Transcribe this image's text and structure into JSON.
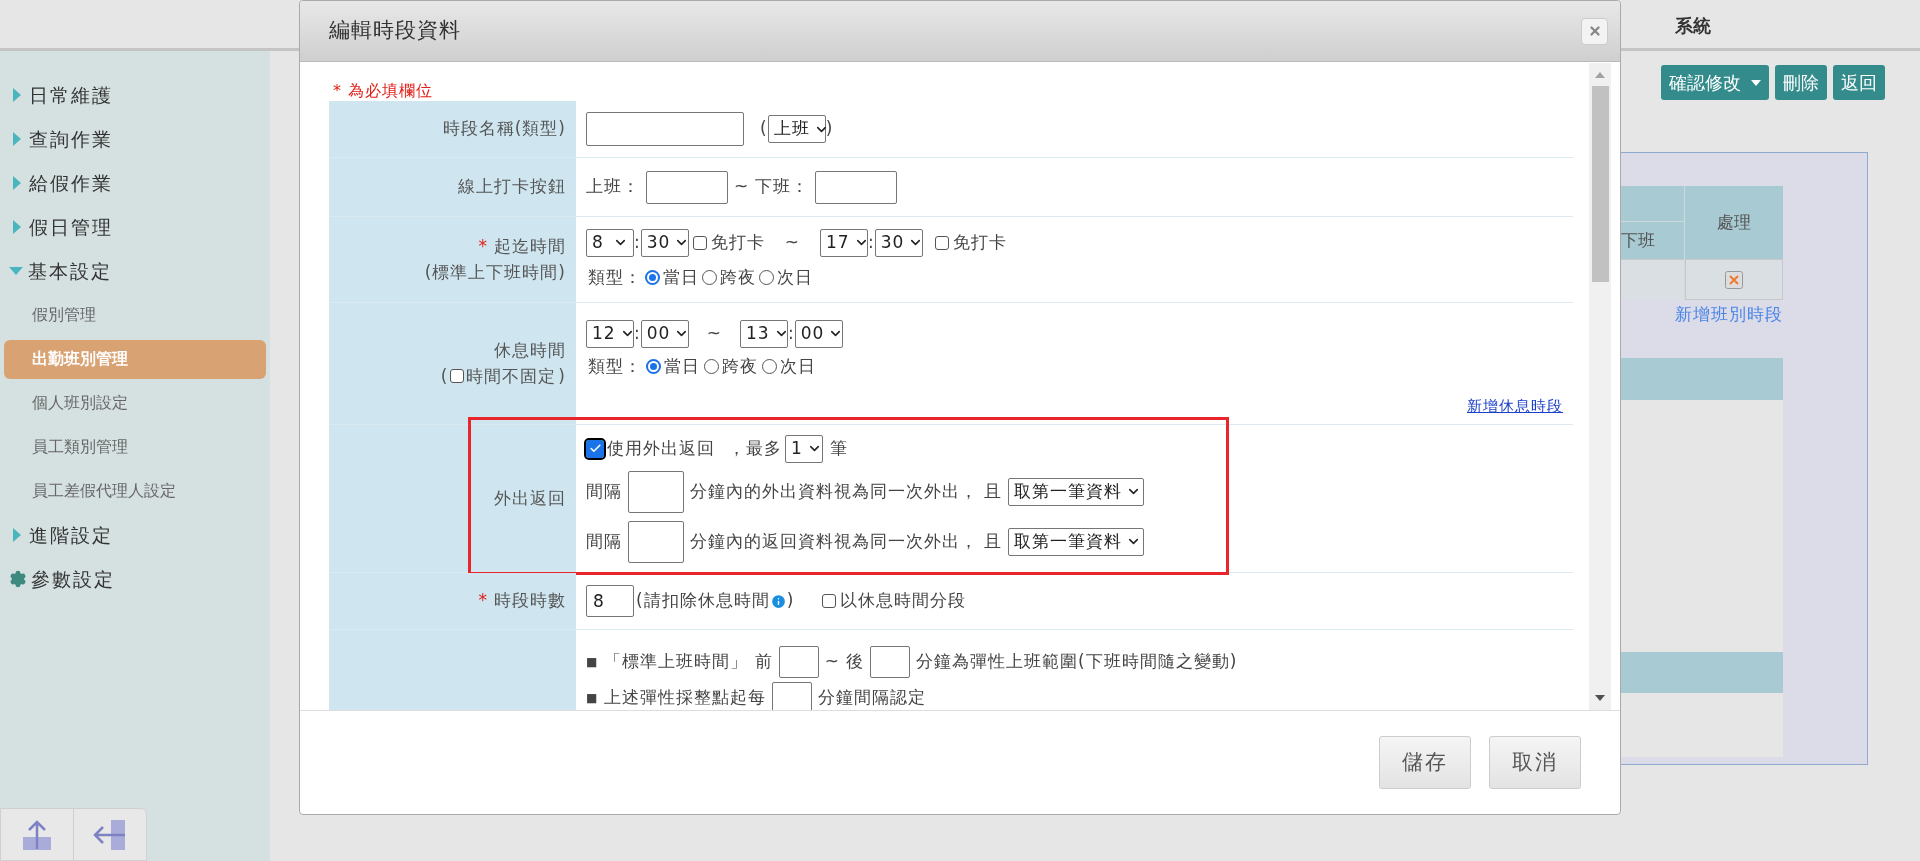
{
  "top_bar": {
    "title": "系統"
  },
  "sidebar": {
    "items": [
      {
        "label": "日常維護",
        "kind": "group",
        "expanded": false
      },
      {
        "label": "查詢作業",
        "kind": "group",
        "expanded": false
      },
      {
        "label": "給假作業",
        "kind": "group",
        "expanded": false
      },
      {
        "label": "假日管理",
        "kind": "group",
        "expanded": false
      },
      {
        "label": "基本設定",
        "kind": "group",
        "expanded": true,
        "children": [
          {
            "label": "假別管理",
            "selected": false
          },
          {
            "label": "出勤班別管理",
            "selected": true
          },
          {
            "label": "個人班別設定",
            "selected": false
          },
          {
            "label": "員工類別管理",
            "selected": false
          },
          {
            "label": "員工差假代理人設定",
            "selected": false
          }
        ]
      },
      {
        "label": "進階設定",
        "kind": "group",
        "expanded": false
      },
      {
        "label": "參數設定",
        "kind": "settings"
      }
    ]
  },
  "toolbar": {
    "buttons": [
      {
        "label": "確認修改",
        "kind": "dropdown"
      },
      {
        "label": "刪除",
        "kind": "plain"
      },
      {
        "label": "返回",
        "kind": "plain"
      }
    ]
  },
  "shift_table": {
    "columns": [
      "下班",
      "處理"
    ],
    "add_link": "新增班別時段"
  },
  "dialog": {
    "title": "編輯時段資料",
    "required_note": "* 為必填欄位",
    "form": {
      "name": {
        "label": "時段名稱(類型)",
        "type_open": "(",
        "type": "上班",
        "type_close": ")"
      },
      "punch_buttons": {
        "label": "線上打卡按鈕",
        "in_label": "上班：",
        "separator": "~",
        "out_label": "下班："
      },
      "work_time": {
        "required_mark": "*",
        "label": "起迄時間",
        "sublabel": "(標準上下班時間)",
        "start": {
          "hour": "8",
          "colon": ":",
          "minute": "30"
        },
        "start_exempt": {
          "label": "免打卡",
          "checked": false
        },
        "separator": "~",
        "end": {
          "hour": "17",
          "colon": ":",
          "minute": "30"
        },
        "end_exempt": {
          "label": "免打卡",
          "checked": false
        },
        "type_label": "類型：",
        "types": [
          {
            "label": "當日",
            "selected": true
          },
          {
            "label": "跨夜",
            "selected": false
          },
          {
            "label": "次日",
            "selected": false
          }
        ]
      },
      "break_time": {
        "label": "休息時間",
        "sublabel_open": "(",
        "flexible": {
          "label": "時間不固定",
          "checked": false
        },
        "sublabel_close": ")",
        "start": {
          "hour": "12",
          "colon": ":",
          "minute": "00"
        },
        "separator": "~",
        "end": {
          "hour": "13",
          "colon": ":",
          "minute": "00"
        },
        "type_label": "類型：",
        "types": [
          {
            "label": "當日",
            "selected": true
          },
          {
            "label": "跨夜",
            "selected": false
          },
          {
            "label": "次日",
            "selected": false
          }
        ],
        "add_link": "新增休息時段"
      },
      "outing": {
        "label": "外出返回",
        "highlighted": true,
        "enabled": {
          "label": "使用外出返回",
          "checked": true
        },
        "max_label": "，最多",
        "max": "1",
        "max_unit": "筆",
        "rules": [
          {
            "prefix": "間隔",
            "text": "分鐘內的外出資料視為同一次外出， 且",
            "choice": "取第一筆資料"
          },
          {
            "prefix": "間隔",
            "text": "分鐘內的返回資料視為同一次外出， 且",
            "choice": "取第一筆資料"
          }
        ]
      },
      "hours": {
        "required_mark": "*",
        "label": "時段時數",
        "value": "8",
        "note_open": "(請扣除休息時間",
        "note_close": ")",
        "split": {
          "label": "以休息時間分段",
          "checked": false
        }
      },
      "flex": {
        "lines": [
          {
            "bullet": "■",
            "parts": [
              {
                "kind": "text",
                "text": "「標準上班時間」 前"
              },
              {
                "kind": "input"
              },
              {
                "kind": "text",
                "text": "~"
              },
              {
                "kind": "text",
                "text": "後"
              },
              {
                "kind": "input"
              },
              {
                "kind": "text",
                "text": "分鐘為彈性上班範圍(下班時間隨之變動)"
              }
            ]
          },
          {
            "bullet": "■",
            "parts": [
              {
                "kind": "text",
                "text": "上述彈性採整點起每"
              },
              {
                "kind": "input"
              },
              {
                "kind": "text",
                "text": "分鐘間隔認定"
              }
            ]
          }
        ]
      }
    },
    "actions": [
      {
        "label": "儲存"
      },
      {
        "label": "取消"
      }
    ]
  }
}
